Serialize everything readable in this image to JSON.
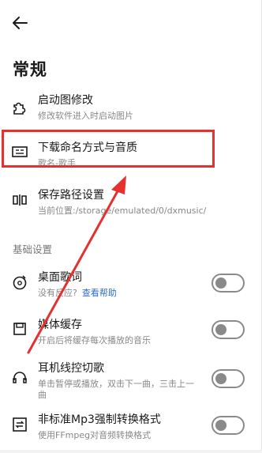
{
  "page": {
    "title": "常规"
  },
  "settings": [
    {
      "title": "启动图修改",
      "subtitle": "修改软件进入时启动图片"
    },
    {
      "title": "下载命名方式与音质",
      "subtitle": "歌名-歌手"
    },
    {
      "title": "保存路径设置",
      "subtitle": "当前位置:/storage/emulated/0/dxmusic/"
    }
  ],
  "section": {
    "label": "基础设置"
  },
  "basic": [
    {
      "title": "桌面歌词",
      "subtitle": "没有反应?",
      "link": "查看帮助",
      "enabled": false
    },
    {
      "title": "媒体缓存",
      "subtitle": "开启后将缓存每次播放的音乐",
      "enabled": false
    },
    {
      "title": "耳机线控切歌",
      "subtitle_line1": "单击暂停或播放，双击下一曲，三击上一",
      "subtitle_line2": "曲",
      "enabled": false
    },
    {
      "title": "非标准Mp3强制转换格式",
      "subtitle": "使用FFmpeg对音频转换格式",
      "enabled": false
    }
  ],
  "annotation_colors": {
    "highlight": "#e53030",
    "arrow": "#e53030"
  },
  "icons": [
    "back-arrow-icon",
    "puzzle-icon",
    "card-icon",
    "folder-split-icon",
    "lyrics-disc-icon",
    "save-cache-icon",
    "headphones-icon",
    "convert-icon"
  ]
}
